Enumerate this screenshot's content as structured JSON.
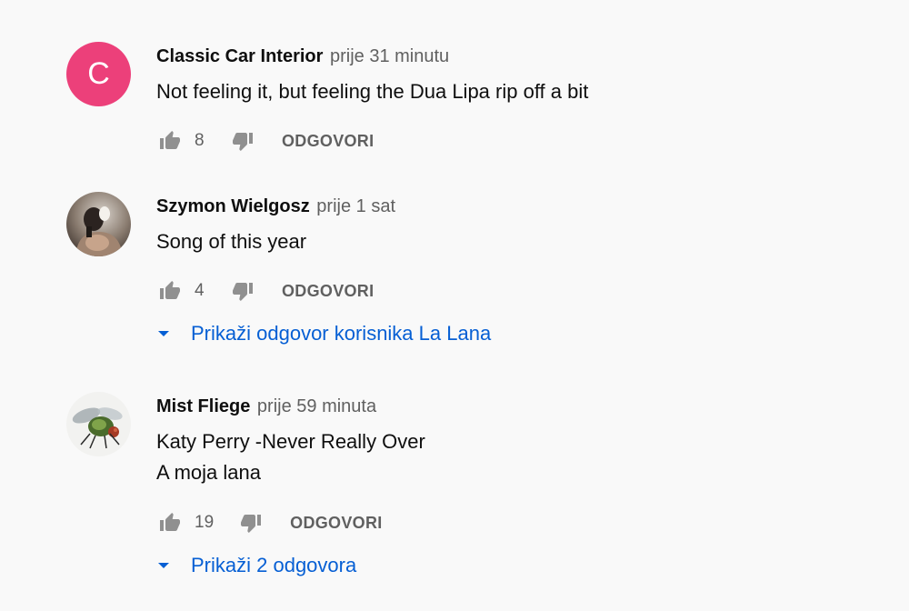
{
  "comments": [
    {
      "author": "Classic Car Interior",
      "time": "prije 31 minutu",
      "avatar_letter": "C",
      "avatar_color": "#ec407a",
      "lines": [
        "Not feeling it, but feeling the Dua Lipa rip off a bit"
      ],
      "likes": "8",
      "reply_label": "ODGOVORI"
    },
    {
      "author": "Szymon Wielgosz",
      "time": "prije 1 sat",
      "avatar_icon": "person-photo",
      "lines": [
        "Song of this year"
      ],
      "likes": "4",
      "reply_label": "ODGOVORI",
      "replies_label": "Prikaži odgovor korisnika La Lana"
    },
    {
      "author": "Mist Fliege",
      "time": "prije 59 minuta",
      "avatar_icon": "fly-photo",
      "lines": [
        "Katy Perry -Never Really Over",
        "A moja lana"
      ],
      "likes": "19",
      "reply_label": "ODGOVORI",
      "replies_label": "Prikaži 2 odgovora"
    }
  ],
  "colors": {
    "background": "#f9f9f9",
    "link": "#065fd4",
    "secondary_text": "#606060"
  },
  "icons": {
    "like": "thumb-up-icon",
    "dislike": "thumb-down-icon",
    "expand": "caret-down-icon"
  }
}
